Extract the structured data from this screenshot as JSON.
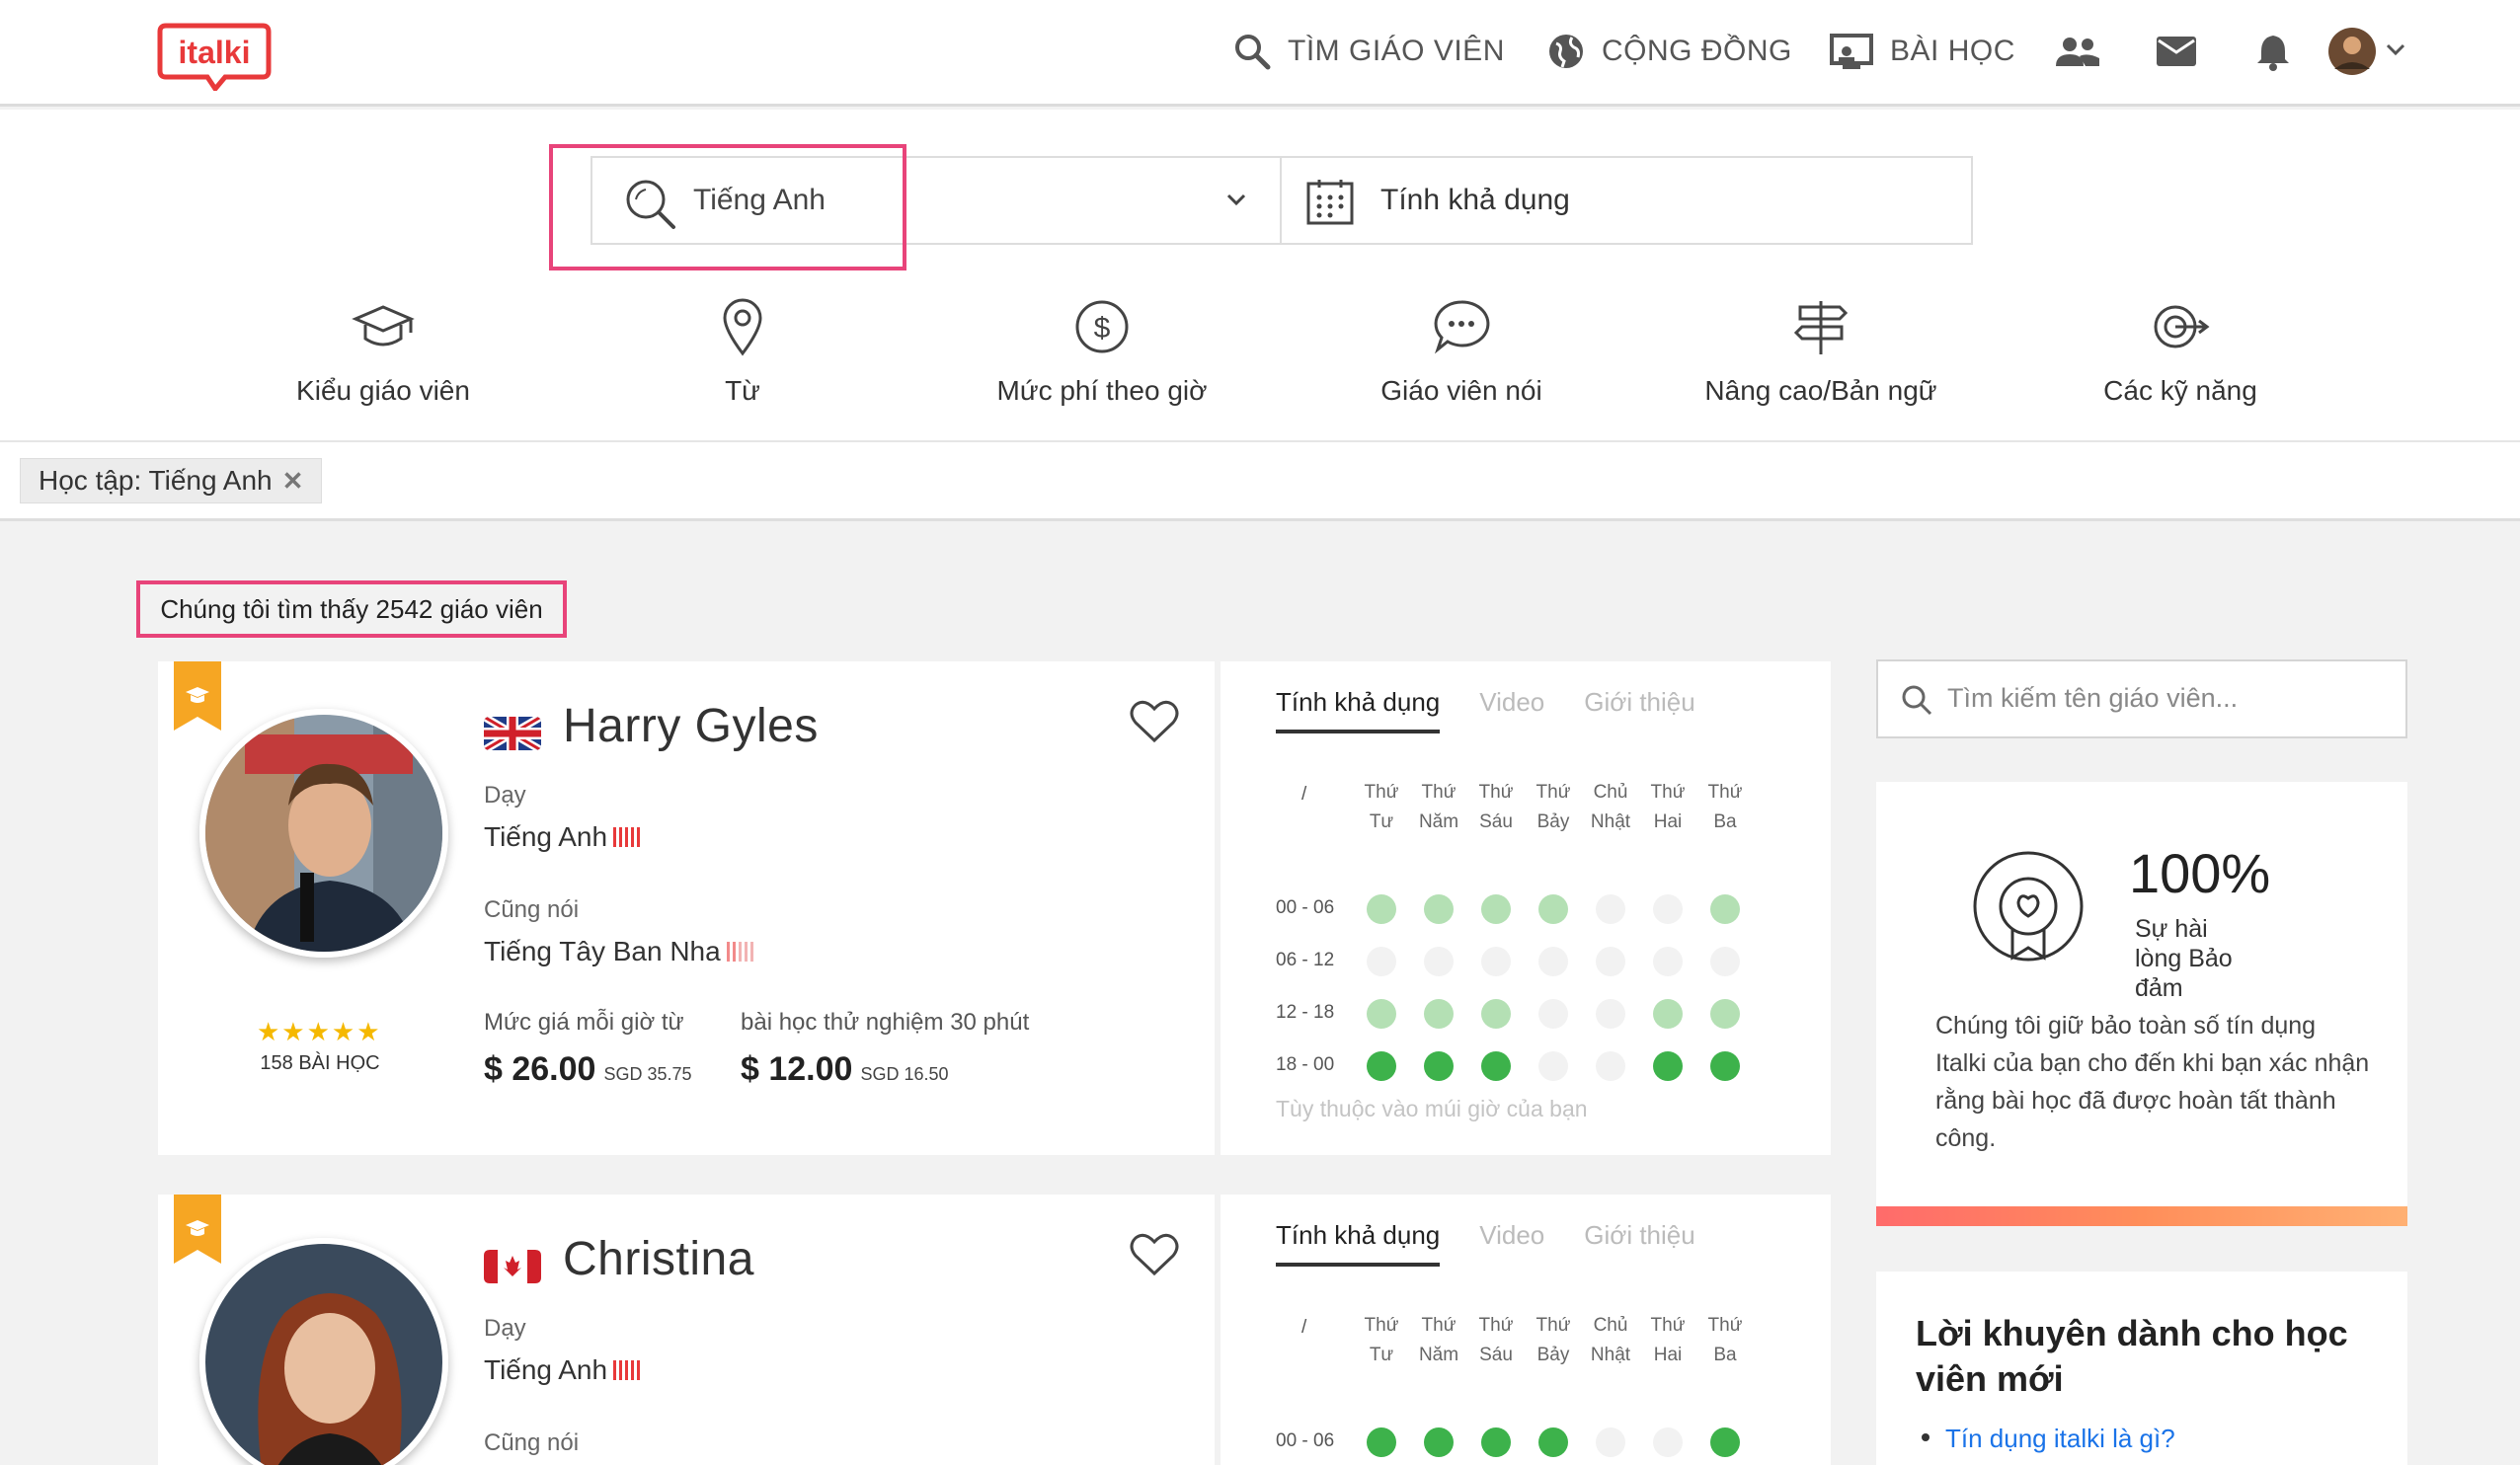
{
  "nav": {
    "logo_text": "italki",
    "find_teacher": "TÌM GIÁO VIÊN",
    "community": "CỘNG ĐỒNG",
    "lessons": "BÀI HỌC"
  },
  "search": {
    "language_value": "Tiếng Anh",
    "availability_label": "Tính khả dụng"
  },
  "filters": [
    {
      "label": "Kiểu giáo viên",
      "icon": "graduation-cap-icon"
    },
    {
      "label": "Từ",
      "icon": "map-pin-icon"
    },
    {
      "label": "Mức phí theo giờ",
      "icon": "dollar-icon"
    },
    {
      "label": "Giáo viên nói",
      "icon": "speech-bubble-icon"
    },
    {
      "label": "Nâng cao/Bản ngữ",
      "icon": "signpost-icon"
    },
    {
      "label": "Các kỹ năng",
      "icon": "target-icon"
    }
  ],
  "active_tag": "Học tập: Tiếng Anh",
  "result_count": "Chúng tôi tìm thấy 2542 giáo viên",
  "teachers": [
    {
      "name": "Harry Gyles",
      "flag": "uk",
      "teaches_label": "Dạy",
      "teaches": "Tiếng Anh",
      "also_speaks_label": "Cũng nói",
      "also_speaks": "Tiếng Tây Ban Nha",
      "stars": "★★★★★",
      "lessons": "158 BÀI HỌC",
      "hourly_label": "Mức giá mỗi giờ từ",
      "hourly_price": "$ 26.00",
      "hourly_sgd": "SGD 35.75",
      "trial_label": "bài học thử nghiệm 30 phút",
      "trial_price": "$ 12.00",
      "trial_sgd": "SGD 16.50"
    },
    {
      "name": "Christina",
      "flag": "canada",
      "teaches_label": "Dạy",
      "teaches": "Tiếng Anh",
      "also_speaks_label": "Cũng nói"
    }
  ],
  "schedule": {
    "tabs": [
      "Tính khả dụng",
      "Video",
      "Giới thiệu"
    ],
    "corner": "/",
    "days": [
      [
        "Thứ",
        "Tư"
      ],
      [
        "Thứ",
        "Năm"
      ],
      [
        "Thứ",
        "Sáu"
      ],
      [
        "Thứ",
        "Bảy"
      ],
      [
        "Chủ",
        "Nhật"
      ],
      [
        "Thứ",
        "Hai"
      ],
      [
        "Thứ",
        "Ba"
      ]
    ],
    "rows": [
      "00 - 06",
      "06 - 12",
      "12 - 18",
      "18 - 00"
    ],
    "card1_levels": [
      [
        1,
        1,
        1,
        1,
        0,
        0,
        1
      ],
      [
        0,
        0,
        0,
        0,
        0,
        0,
        0
      ],
      [
        1,
        1,
        1,
        0,
        0,
        1,
        1
      ],
      [
        2,
        2,
        2,
        0,
        0,
        2,
        2
      ]
    ],
    "card2_levels": [
      [
        2,
        2,
        2,
        2,
        0,
        0,
        2
      ]
    ],
    "tz_note": "Tùy thuộc vào múi giờ của bạn",
    "colors": {
      "empty": "#f2f2f2",
      "light": "#b4e0b4",
      "full": "#3db24b"
    }
  },
  "sidebar": {
    "search_placeholder": "Tìm kiếm tên giáo viên...",
    "guarantee_percent": "100%",
    "guarantee_sub": "Sự hài lòng Bảo đảm",
    "guarantee_text": "Chúng tôi giữ bảo toàn số tín dụng Italki của bạn cho đến khi bạn xác nhận rằng bài học đã được hoàn tất thành công.",
    "tips_title": "Lời khuyên dành cho học viên mới",
    "tips_link": "Tín dụng italki là gì?"
  }
}
